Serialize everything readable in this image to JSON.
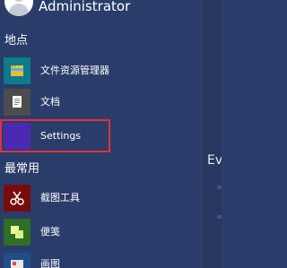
{
  "start_menu": {
    "user": {
      "name": "Administrator"
    },
    "places": {
      "title": "地点",
      "items": [
        {
          "label": "文件资源管理器",
          "icon": "folder-icon",
          "tile_color": "#0c7b8c"
        },
        {
          "label": "文档",
          "icon": "document-icon",
          "tile_color": "#4c4c4c"
        },
        {
          "label": "Settings",
          "icon": "settings-icon",
          "tile_color": "#4b2ab2"
        }
      ]
    },
    "most_used": {
      "title": "最常用",
      "items": [
        {
          "label": "截图工具",
          "icon": "scissors-icon",
          "tile_color": "#7a0b0b"
        },
        {
          "label": "便笺",
          "icon": "sticky-note-icon",
          "tile_color": "#2e6e25"
        },
        {
          "label": "画图",
          "icon": "paint-icon",
          "tile_color": "#1e4f8c"
        }
      ]
    },
    "highlight": {
      "color": "#e0313a",
      "target": "Settings"
    }
  },
  "desktop": {
    "partial_text": "Ev"
  }
}
